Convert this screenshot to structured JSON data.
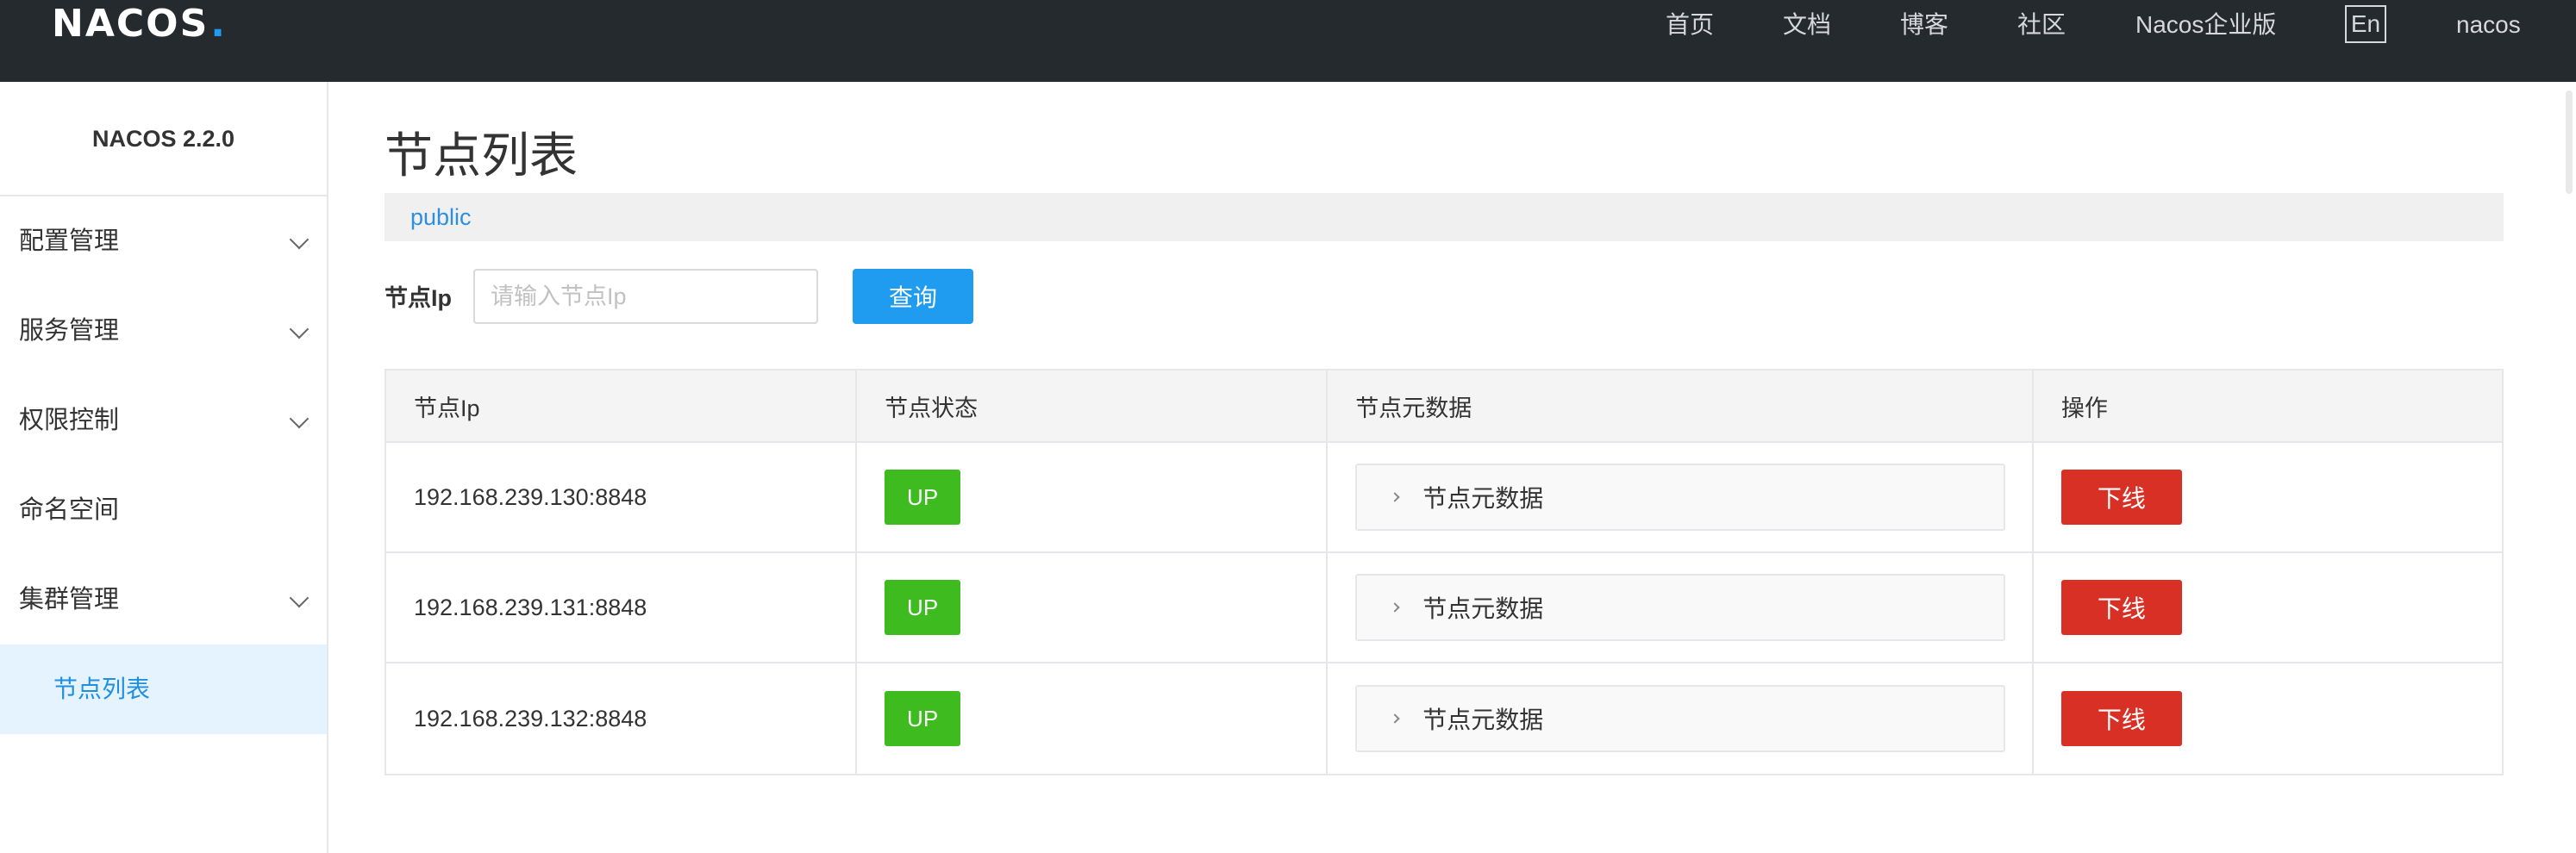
{
  "header": {
    "logo_text": "NACOS",
    "nav": [
      {
        "label": "首页"
      },
      {
        "label": "文档"
      },
      {
        "label": "博客"
      },
      {
        "label": "社区"
      },
      {
        "label": "Nacos企业版"
      }
    ],
    "lang": "En",
    "user": "nacos"
  },
  "sidebar": {
    "title": "NACOS 2.2.0",
    "items": [
      {
        "label": "配置管理",
        "expandable": true
      },
      {
        "label": "服务管理",
        "expandable": true
      },
      {
        "label": "权限控制",
        "expandable": true
      },
      {
        "label": "命名空间",
        "expandable": false
      },
      {
        "label": "集群管理",
        "expandable": true
      }
    ],
    "sub_item": "节点列表"
  },
  "main": {
    "title": "节点列表",
    "namespace": "public",
    "search": {
      "label": "节点Ip",
      "placeholder": "请输入节点Ip",
      "value": "",
      "button": "查询"
    },
    "table": {
      "headers": [
        "节点Ip",
        "节点状态",
        "节点元数据",
        "操作"
      ],
      "rows": [
        {
          "ip": "192.168.239.130:8848",
          "status": "UP",
          "meta": "节点元数据",
          "action": "下线"
        },
        {
          "ip": "192.168.239.131:8848",
          "status": "UP",
          "meta": "节点元数据",
          "action": "下线"
        },
        {
          "ip": "192.168.239.132:8848",
          "status": "UP",
          "meta": "节点元数据",
          "action": "下线"
        }
      ]
    }
  },
  "colors": {
    "header_bg": "#252a2f",
    "accent": "#1f9bf0",
    "status_up": "#3dbb1f",
    "danger": "#d93026"
  }
}
